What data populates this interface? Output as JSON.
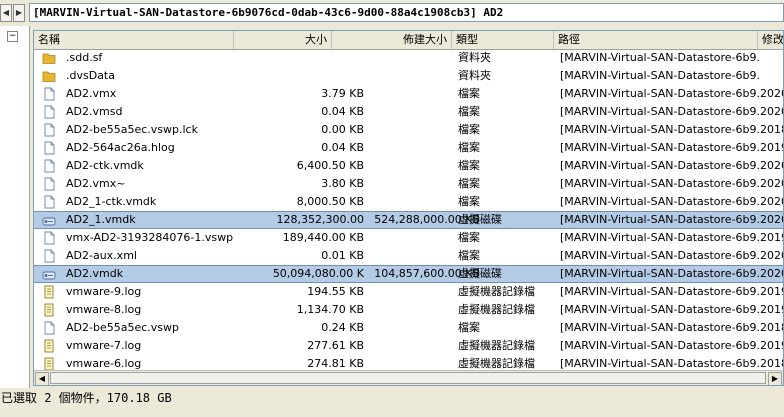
{
  "nav": {
    "back": "◀",
    "forward": "▶"
  },
  "path": "[MARVIN-Virtual-SAN-Datastore-6b9076cd-0dab-43c6-9d00-88a4c1908cb3] AD2",
  "tree": {
    "toggle": "−"
  },
  "columns": {
    "name": "名稱",
    "size": "大小",
    "provisioned": "佈建大小",
    "type": "類型",
    "path": "路徑",
    "modified": "修改"
  },
  "rows": [
    {
      "icon": "folder",
      "name": ".sdd.sf",
      "size": "",
      "provisioned": "",
      "type": "資料夾",
      "path": "[MARVIN-Virtual-SAN-Datastore-6b9...",
      "modified": ""
    },
    {
      "icon": "folder",
      "name": ".dvsData",
      "size": "",
      "provisioned": "",
      "type": "資料夾",
      "path": "[MARVIN-Virtual-SAN-Datastore-6b9...",
      "modified": ""
    },
    {
      "icon": "file",
      "name": "AD2.vmx",
      "size": "3.79 KB",
      "provisioned": "",
      "type": "檔案",
      "path": "[MARVIN-Virtual-SAN-Datastore-6b9...",
      "modified": "2020"
    },
    {
      "icon": "file",
      "name": "AD2.vmsd",
      "size": "0.04 KB",
      "provisioned": "",
      "type": "檔案",
      "path": "[MARVIN-Virtual-SAN-Datastore-6b9...",
      "modified": "2020"
    },
    {
      "icon": "file",
      "name": "AD2-be55a5ec.vswp.lck",
      "size": "0.00 KB",
      "provisioned": "",
      "type": "檔案",
      "path": "[MARVIN-Virtual-SAN-Datastore-6b9...",
      "modified": "2018"
    },
    {
      "icon": "file",
      "name": "AD2-564ac26a.hlog",
      "size": "0.04 KB",
      "provisioned": "",
      "type": "檔案",
      "path": "[MARVIN-Virtual-SAN-Datastore-6b9...",
      "modified": "2019"
    },
    {
      "icon": "file",
      "name": "AD2-ctk.vmdk",
      "size": "6,400.50 KB",
      "provisioned": "",
      "type": "檔案",
      "path": "[MARVIN-Virtual-SAN-Datastore-6b9...",
      "modified": "2020"
    },
    {
      "icon": "file",
      "name": "AD2.vmx~",
      "size": "3.80 KB",
      "provisioned": "",
      "type": "檔案",
      "path": "[MARVIN-Virtual-SAN-Datastore-6b9...",
      "modified": "2020"
    },
    {
      "icon": "file",
      "name": "AD2_1-ctk.vmdk",
      "size": "8,000.50 KB",
      "provisioned": "",
      "type": "檔案",
      "path": "[MARVIN-Virtual-SAN-Datastore-6b9...",
      "modified": "2020"
    },
    {
      "icon": "disk",
      "name": "AD2_1.vmdk",
      "size": "128,352,300.00",
      "provisioned": "524,288,000.00 KB",
      "type": "虛擬磁碟",
      "path": "[MARVIN-Virtual-SAN-Datastore-6b9...",
      "modified": "2020",
      "selected": true
    },
    {
      "icon": "file",
      "name": "vmx-AD2-3193284076-1.vswp",
      "size": "189,440.00 KB",
      "provisioned": "",
      "type": "檔案",
      "path": "[MARVIN-Virtual-SAN-Datastore-6b9...",
      "modified": "2019"
    },
    {
      "icon": "file",
      "name": "AD2-aux.xml",
      "size": "0.01 KB",
      "provisioned": "",
      "type": "檔案",
      "path": "[MARVIN-Virtual-SAN-Datastore-6b9...",
      "modified": "2020"
    },
    {
      "icon": "disk",
      "name": "AD2.vmdk",
      "size": "50,094,080.00 K",
      "provisioned": "104,857,600.00 KB",
      "type": "虛擬磁碟",
      "path": "[MARVIN-Virtual-SAN-Datastore-6b9...",
      "modified": "2020",
      "selected": true
    },
    {
      "icon": "log",
      "name": "vmware-9.log",
      "size": "194.55 KB",
      "provisioned": "",
      "type": "虛擬機器記錄檔",
      "path": "[MARVIN-Virtual-SAN-Datastore-6b9...",
      "modified": "2019"
    },
    {
      "icon": "log",
      "name": "vmware-8.log",
      "size": "1,134.70 KB",
      "provisioned": "",
      "type": "虛擬機器記錄檔",
      "path": "[MARVIN-Virtual-SAN-Datastore-6b9...",
      "modified": "2019"
    },
    {
      "icon": "file",
      "name": "AD2-be55a5ec.vswp",
      "size": "0.24 KB",
      "provisioned": "",
      "type": "檔案",
      "path": "[MARVIN-Virtual-SAN-Datastore-6b9...",
      "modified": "2018"
    },
    {
      "icon": "log",
      "name": "vmware-7.log",
      "size": "277.61 KB",
      "provisioned": "",
      "type": "虛擬機器記錄檔",
      "path": "[MARVIN-Virtual-SAN-Datastore-6b9...",
      "modified": "2019"
    },
    {
      "icon": "log",
      "name": "vmware-6.log",
      "size": "274.81 KB",
      "provisioned": "",
      "type": "虛擬機器記錄檔",
      "path": "[MARVIN-Virtual-SAN-Datastore-6b9...",
      "modified": "2018"
    }
  ],
  "scrollbar": {
    "left": "◀",
    "right": "▶"
  },
  "status": "已選取 2 個物件，170.18 GB"
}
